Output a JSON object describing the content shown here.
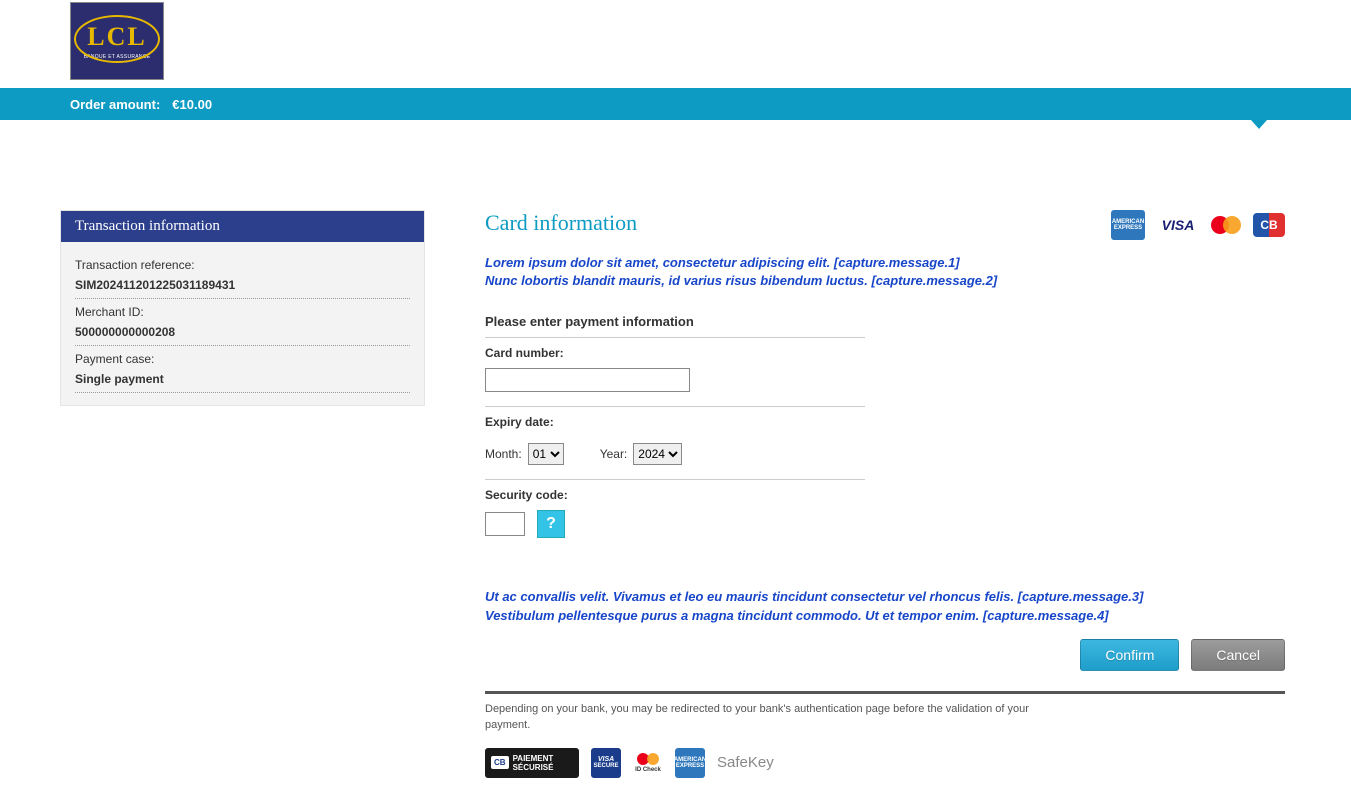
{
  "logo": {
    "text": "LCL",
    "sub": "BANQUE ET ASSURANCE"
  },
  "amount_bar": {
    "label": "Order amount:",
    "value": "€10.00"
  },
  "transaction_box": {
    "title": "Transaction information",
    "rows": [
      {
        "label": "Transaction reference:",
        "value": "SIM202411201225031189431"
      },
      {
        "label": "Merchant ID:",
        "value": "500000000000208"
      },
      {
        "label": "Payment case:",
        "value": "Single payment"
      }
    ]
  },
  "card_section": {
    "title": "Card information",
    "brands": [
      "AMEX",
      "VISA",
      "mastercard",
      "CB"
    ],
    "msg1": "Lorem ipsum dolor sit amet, consectetur adipiscing elit. [capture.message.1]",
    "msg2": "Nunc lobortis blandit mauris, id varius risus bibendum luctus. [capture.message.2]",
    "enter_info": "Please enter payment information",
    "card_num_label": "Card number:",
    "expiry_label": "Expiry date:",
    "month_label": "Month:",
    "month_value": "01",
    "year_label": "Year:",
    "year_value": "2024",
    "sec_label": "Security code:",
    "help": "?",
    "msg3": "Ut ac convallis velit. Vivamus et leo eu mauris tincidunt consectetur vel rhoncus felis. [capture.message.3]",
    "msg4": "Vestibulum pellentesque purus a magna tincidunt commodo. Ut et tempor enim. [capture.message.4]",
    "confirm": "Confirm",
    "cancel": "Cancel",
    "footnote": "Depending on your bank, you may be redirected to your bank's authentication page before the validation of your payment.",
    "secure_labels": {
      "paiement": "PAIEMENT SÉCURISÉ",
      "visa": "visa SECURE",
      "mc": "ID Check",
      "amex": "AMERICAN EXPRESS",
      "safekey": "SafeKey"
    }
  }
}
